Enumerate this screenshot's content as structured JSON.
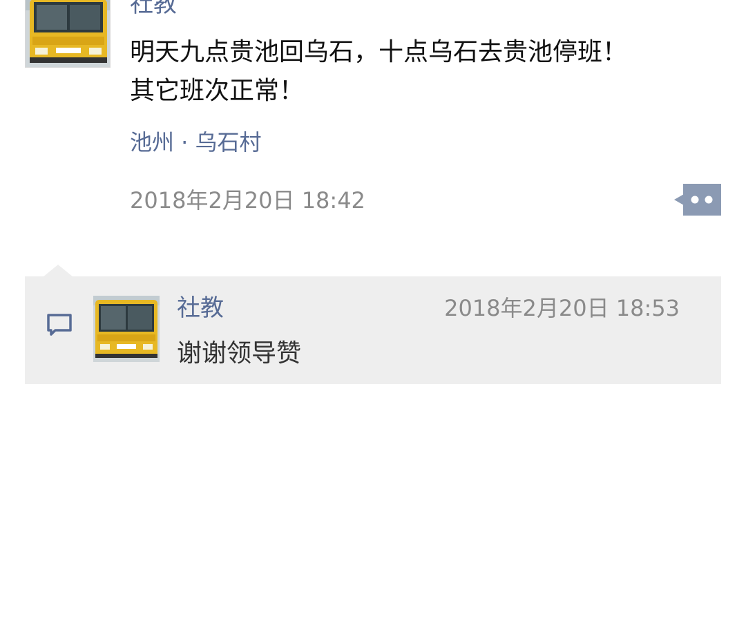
{
  "post": {
    "author": "社教",
    "text": "明天九点贵池回乌石，十点乌石去贵池停班！\n其它班次正常！",
    "location": "池州 · 乌石村",
    "timestamp": "2018年2月20日 18:42",
    "more_icon": "ellipsis-icon"
  },
  "comment": {
    "author": "社教",
    "timestamp": "2018年2月20日 18:53",
    "text": "谢谢领导赞",
    "icon": "comment-icon"
  },
  "colors": {
    "link": "#576b95",
    "comment_bg": "#eeeeee",
    "text": "#111111",
    "muted": "#8a8a8a"
  }
}
